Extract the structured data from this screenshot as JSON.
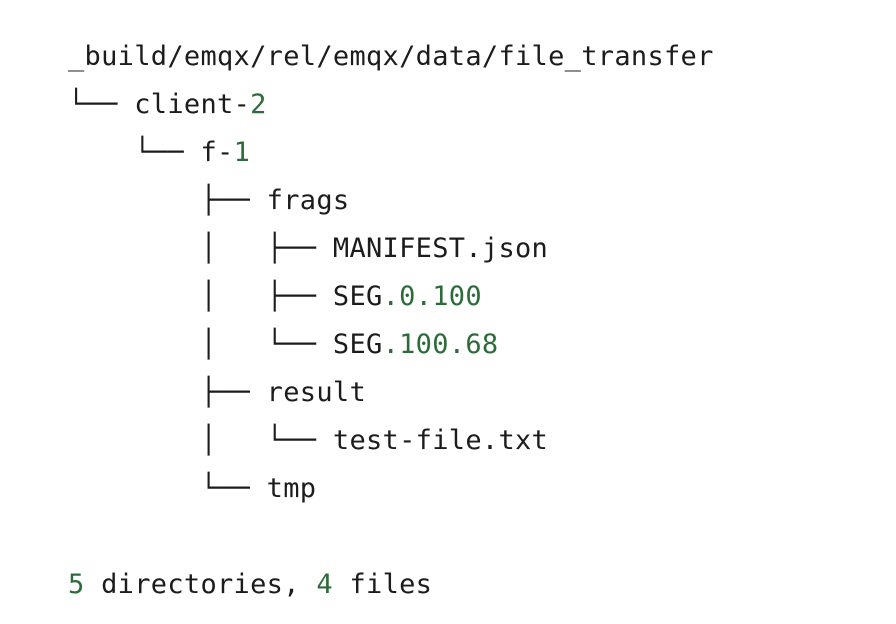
{
  "root_path": "_build/emqx/rel/emqx/data/file_transfer",
  "tree": [
    {
      "prefix": "└── ",
      "name": "client-",
      "num": "2"
    },
    {
      "prefix": "    └── ",
      "name": "f-",
      "num": "1"
    },
    {
      "prefix": "        ├── ",
      "name": "frags",
      "num": ""
    },
    {
      "prefix": "        │   ├── ",
      "name": "MANIFEST.json",
      "num": ""
    },
    {
      "prefix": "        │   ├── ",
      "name": "SEG",
      "num": ".0.100"
    },
    {
      "prefix": "        │   └── ",
      "name": "SEG",
      "num": ".100.68"
    },
    {
      "prefix": "        ├── ",
      "name": "result",
      "num": ""
    },
    {
      "prefix": "        │   └── ",
      "name": "test-file.txt",
      "num": ""
    },
    {
      "prefix": "        └── ",
      "name": "tmp",
      "num": ""
    }
  ],
  "summary": {
    "dir_count": "5",
    "dir_label": " directories, ",
    "file_count": "4",
    "file_label": " files"
  },
  "colors": {
    "text": "#1c1c1c",
    "number": "#2e6b3a",
    "background": "#ffffff"
  }
}
